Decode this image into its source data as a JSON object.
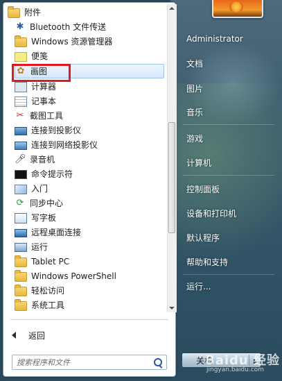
{
  "programs": {
    "folder_label": "附件",
    "items": [
      {
        "label": "Bluetooth 文件传送",
        "icon": "bluetooth-icon"
      },
      {
        "label": "Windows 资源管理器",
        "icon": "explorer-folder-icon"
      },
      {
        "label": "便笺",
        "icon": "sticky-notes-icon"
      },
      {
        "label": "画图",
        "icon": "paint-palette-icon"
      },
      {
        "label": "计算器",
        "icon": "calculator-icon"
      },
      {
        "label": "记事本",
        "icon": "notepad-icon"
      },
      {
        "label": "截图工具",
        "icon": "snipping-tool-icon"
      },
      {
        "label": "连接到投影仪",
        "icon": "projector-icon"
      },
      {
        "label": "连接到网络投影仪",
        "icon": "network-projector-icon"
      },
      {
        "label": "录音机",
        "icon": "microphone-icon"
      },
      {
        "label": "命令提示符",
        "icon": "command-prompt-icon"
      },
      {
        "label": "入门",
        "icon": "getting-started-icon"
      },
      {
        "label": "同步中心",
        "icon": "sync-center-icon"
      },
      {
        "label": "写字板",
        "icon": "wordpad-icon"
      },
      {
        "label": "远程桌面连接",
        "icon": "remote-desktop-icon"
      },
      {
        "label": "运行",
        "icon": "run-icon"
      },
      {
        "label": "Tablet PC",
        "icon": "folder-icon"
      },
      {
        "label": "Windows PowerShell",
        "icon": "folder-icon"
      },
      {
        "label": "轻松访问",
        "icon": "folder-icon"
      },
      {
        "label": "系统工具",
        "icon": "folder-icon"
      }
    ],
    "selected_index": 3
  },
  "back_label": "返回",
  "search": {
    "placeholder": "搜索程序和文件"
  },
  "right_menu": {
    "user": "Administrator",
    "items": [
      "文档",
      "图片",
      "音乐",
      "游戏",
      "计算机",
      "控制面板",
      "设备和打印机",
      "默认程序",
      "帮助和支持",
      "运行..."
    ]
  },
  "shutdown_label": "关机",
  "watermark": {
    "brand": "Baidu 经验",
    "url": "jingyan.baidu.com"
  },
  "colors": {
    "highlight_border": "#e0181f",
    "selection_fill": "#d6e8fb",
    "panel_bg": "#ffffff"
  }
}
